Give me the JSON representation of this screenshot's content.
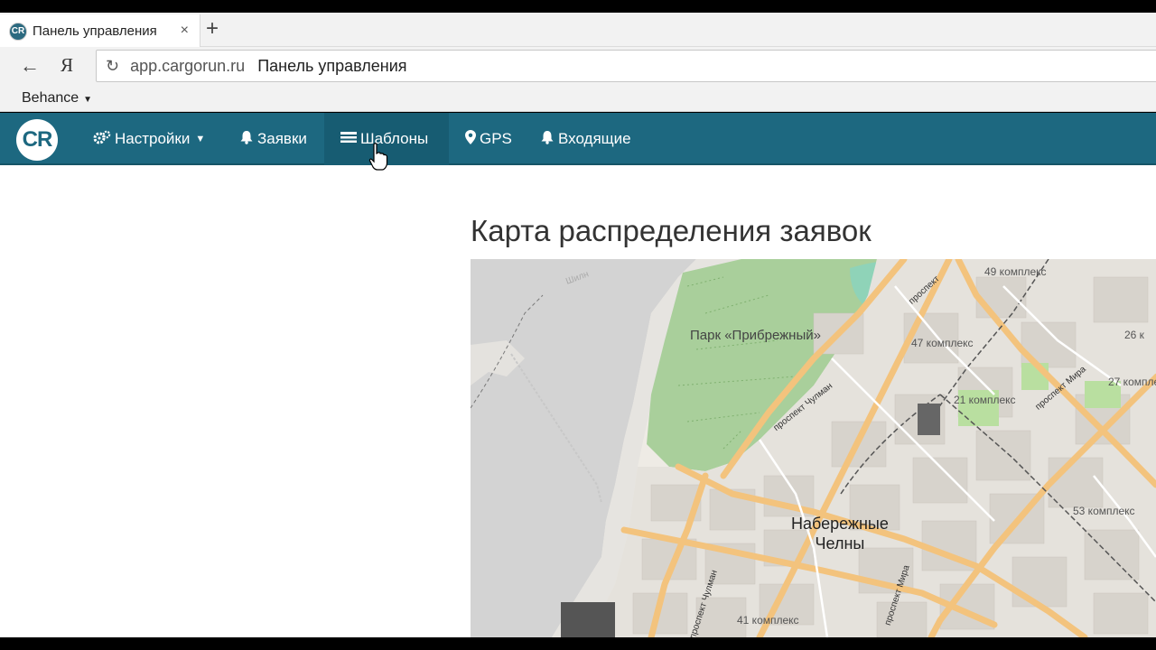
{
  "browser": {
    "tab": {
      "favicon_text": "CR",
      "title": "Панель управления",
      "close_symbol": "×"
    },
    "new_tab_symbol": "+",
    "address": {
      "domain": "app.cargorun.ru",
      "page_title": "Панель управления"
    },
    "nav": {
      "back_symbol": "←",
      "yandex_symbol": "Я",
      "reload_symbol": "↻"
    },
    "bookmarks": [
      {
        "label": "Behance"
      }
    ]
  },
  "app": {
    "logo_text": "CR",
    "nav": [
      {
        "label": "Настройки",
        "icon": "gears-icon",
        "has_caret": true
      },
      {
        "label": "Заявки",
        "icon": "bell-icon"
      },
      {
        "label": "Шаблоны",
        "icon": "list-icon",
        "active": true
      },
      {
        "label": "GPS",
        "icon": "map-marker-icon"
      },
      {
        "label": "Входящие",
        "icon": "bell-icon"
      }
    ]
  },
  "page": {
    "title": "Карта распределения заявок"
  },
  "map": {
    "labels": {
      "park": "Парк «Прибрежный»",
      "city_line1": "Набережные",
      "city_line2": "Челны",
      "d49": "49 комплекс",
      "d47": "47 комплекс",
      "d26": "26 к",
      "d27": "27 комплек",
      "d21": "21 комплекс",
      "d53": "53 комплекс",
      "d41": "41 комплекс",
      "prospekt_chulman": "проспект Чулман",
      "prospekt_mira": "проспект Мира",
      "prospekt_shcherbak": "проспект",
      "chulman_bottom": "проспект Чулман",
      "mira_bottom": "проспект Мира",
      "shilna": "Шилн"
    }
  }
}
